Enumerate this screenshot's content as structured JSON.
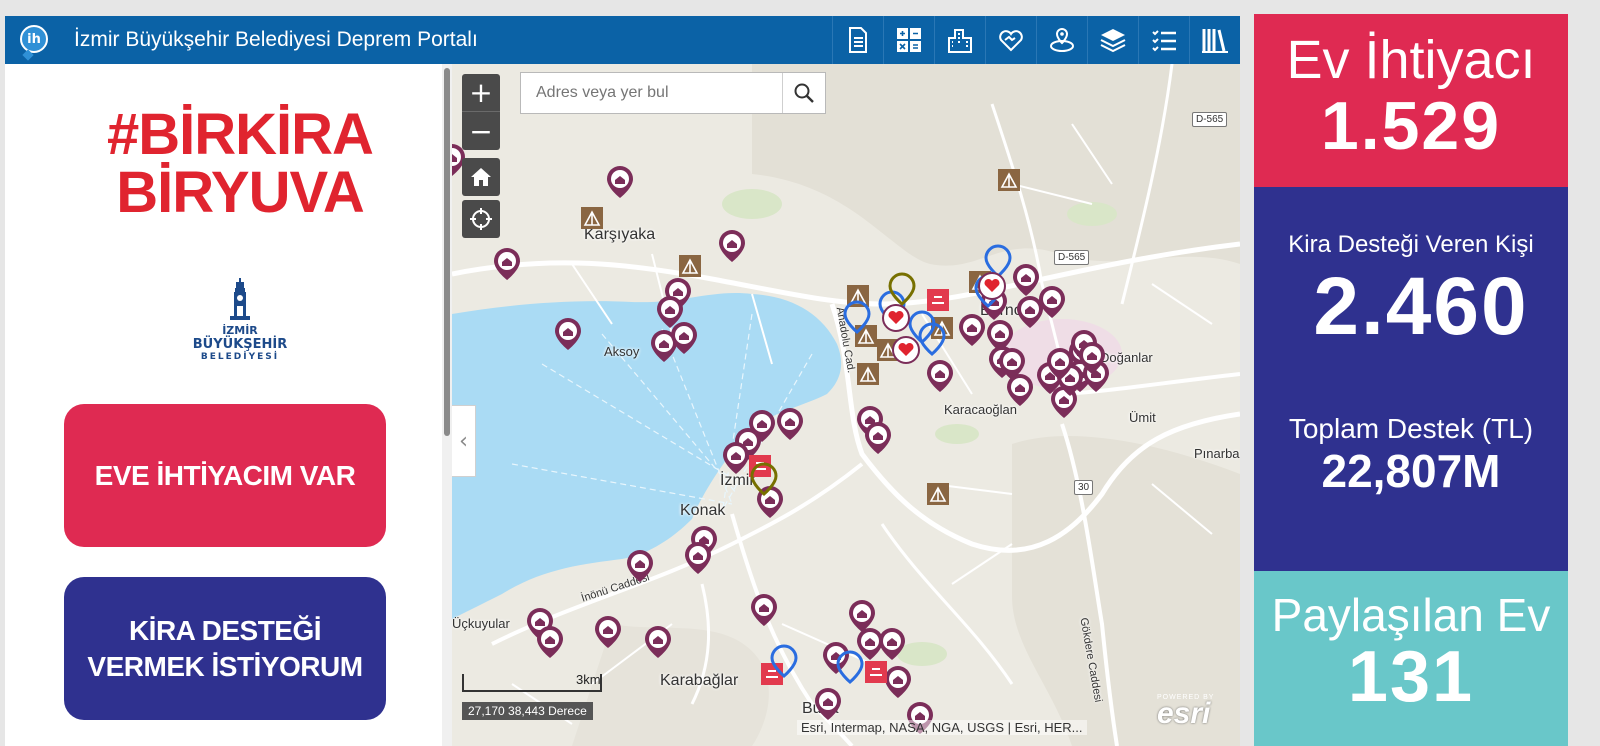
{
  "header": {
    "logo_text": "ih",
    "title": "İzmir Büyükşehir Belediyesi Deprem Portalı",
    "tools": [
      {
        "name": "document-icon"
      },
      {
        "name": "calculator-icon"
      },
      {
        "name": "buildings-icon"
      },
      {
        "name": "heart-hands-icon"
      },
      {
        "name": "map-pin-icon"
      },
      {
        "name": "layers-icon"
      },
      {
        "name": "list-icon"
      },
      {
        "name": "library-icon"
      }
    ]
  },
  "left_panel": {
    "brand_line1": "#BİRKİRA",
    "brand_line2": "BİRYUVA",
    "muni_line1": "İZMİR",
    "muni_line2": "BÜYÜKŞEHİR",
    "muni_line3": "BELEDİYESİ",
    "btn_need": "EVE İHTİYACIM VAR",
    "btn_give_line1": "KİRA DESTEĞİ",
    "btn_give_line2": "VERMEK İSTİYORUM"
  },
  "map": {
    "search_placeholder": "Adres veya yer bul",
    "zoom_in": "+",
    "zoom_out": "−",
    "scale_label": "3km",
    "coords": "27,170 38,443 Derece",
    "attribution": "Esri, Intermap, NASA, NGA, USGS | Esri, HER...",
    "esri_powered": "POWERED BY",
    "esri_word": "esri",
    "labels": {
      "karsiyaka": "Karşıyaka",
      "aksoy": "Aksoy",
      "bornova": "Bornova",
      "doganlar": "Doğanlar",
      "karacaoglan": "Karacaoğlan",
      "umit": "Ümit",
      "pinarbasi": "Pınarba",
      "izmir": "İzmir",
      "konak": "Konak",
      "uckuyular": "Üçkuyular",
      "karabaglar": "Karabağlar",
      "buca": "Buca",
      "inonu": "İnönü Caddesi",
      "anadolu": "Anadolu Cad.",
      "gokdere": "Gökdere Caddesi",
      "d565a": "D-565",
      "d565b": "D-565",
      "r30": "30"
    }
  },
  "stats": {
    "need_label": "Ev İhtiyacı",
    "need_value": "1.529",
    "support_label": "Kira Desteği Veren Kişi",
    "support_value": "2.460",
    "total_label": "Toplam Destek (TL)",
    "total_value": "22,807M",
    "shared_label": "Paylaşılan Ev",
    "shared_value": "131"
  }
}
